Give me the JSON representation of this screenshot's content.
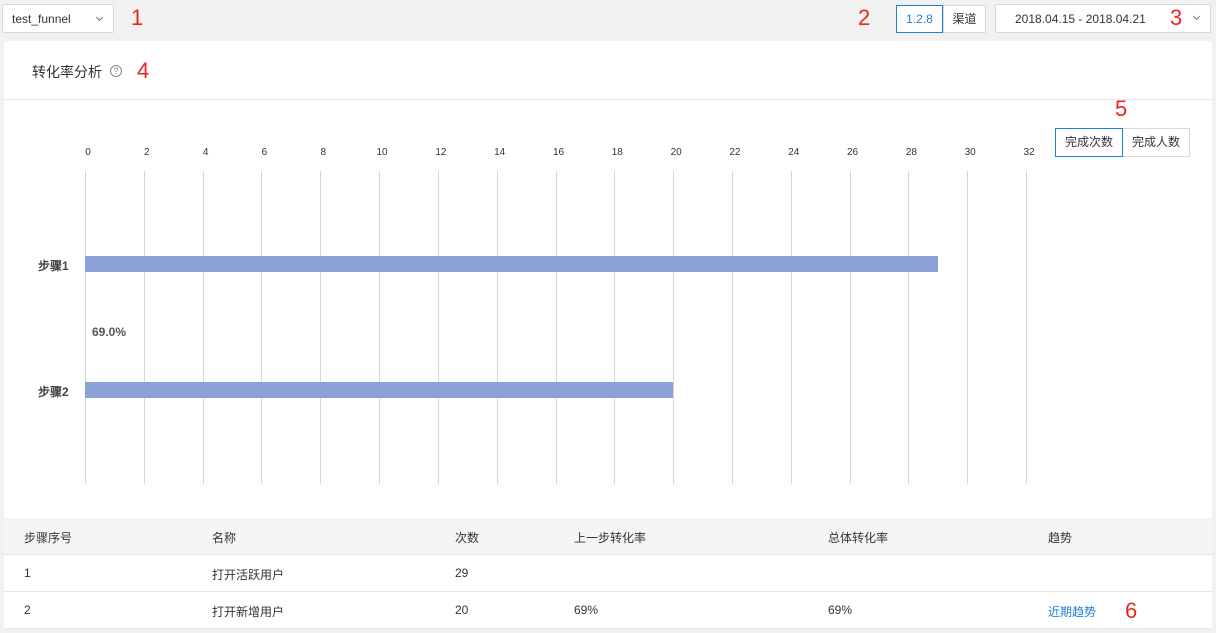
{
  "toolbar": {
    "funnel_select": "test_funnel",
    "version": "1.2.8",
    "channel": "渠道",
    "date_range": "2018.04.15 - 2018.04.21"
  },
  "annotations": [
    "1",
    "2",
    "3",
    "4",
    "5",
    "6"
  ],
  "card": {
    "title": "转化率分析",
    "help_icon": "?",
    "toggles": [
      "完成次数",
      "完成人数"
    ],
    "active_toggle": "完成次数"
  },
  "chart_data": {
    "type": "bar",
    "orientation": "horizontal",
    "categories": [
      "步骤1",
      "步骤2"
    ],
    "values": [
      29,
      20
    ],
    "x_ticks": [
      "0",
      "2",
      "4",
      "6",
      "8",
      "10",
      "12",
      "14",
      "16",
      "18",
      "20",
      "22",
      "24",
      "26",
      "28",
      "30",
      "32"
    ],
    "xlim": [
      0,
      32
    ],
    "conversion_label": "69.0%",
    "grid": true,
    "bar_color": "#8ca0d8"
  },
  "table": {
    "headers": [
      "步骤序号",
      "名称",
      "次数",
      "上一步转化率",
      "总体转化率",
      "趋势"
    ],
    "rows": [
      [
        "1",
        "打开活跃用户",
        "29",
        "",
        "",
        ""
      ],
      [
        "2",
        "打开新增用户",
        "20",
        "69%",
        "69%",
        "近期趋势"
      ]
    ]
  },
  "colors": {
    "accent": "#1e7fd6",
    "annotation": "#e8281e"
  }
}
